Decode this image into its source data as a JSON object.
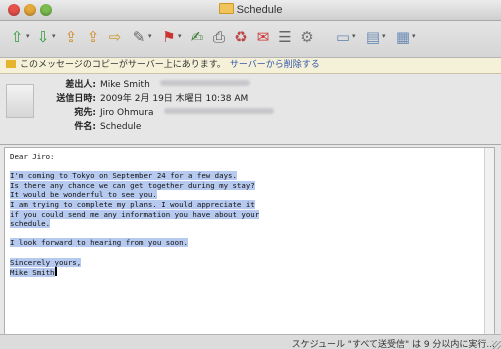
{
  "window": {
    "title": "Schedule"
  },
  "toolbar": {
    "icons": [
      "reply-icon",
      "reply-all-icon",
      "forward-icon",
      "redirect-icon",
      "move-icon",
      "attach-icon",
      "flag-icon",
      "compose-icon",
      "print-icon",
      "delete-icon",
      "junk-icon",
      "list-icon",
      "filter-icon",
      "folder-view-icon",
      "view-icon",
      "more-icon"
    ]
  },
  "notice": {
    "text": "このメッセージのコピーがサーバー上にあります。",
    "link": "サーバーから削除する"
  },
  "header": {
    "from_label": "差出人:",
    "from_value": "Mike Smith",
    "date_label": "送信日時:",
    "date_value": "2009年 2月 19日 木曜日 10:38 AM",
    "to_label": "宛先:",
    "to_value": "Jiro Ohmura",
    "subject_label": "件名:",
    "subject_value": "Schedule"
  },
  "message": {
    "lines": [
      {
        "text": "Dear Jiro:",
        "highlight": false
      },
      {
        "text": "",
        "highlight": false
      },
      {
        "text": "I'm coming to Tokyo on September 24 for a few days.",
        "highlight": true
      },
      {
        "text": "Is there any chance we can get together during my stay?",
        "highlight": true
      },
      {
        "text": "It would be wonderful to see you.",
        "highlight": true
      },
      {
        "text": "I am trying to complete my plans. I would appreciate it",
        "highlight": true
      },
      {
        "text": "if you could send me any information you have about your",
        "highlight": true
      },
      {
        "text": "schedule.",
        "highlight": true
      },
      {
        "text": "",
        "highlight": false
      },
      {
        "text": "I look forward to hearing from you soon.",
        "highlight": true
      },
      {
        "text": "",
        "highlight": false
      },
      {
        "text": "Sincerely yours,",
        "highlight": true
      },
      {
        "text": "Mike Smith",
        "highlight": true
      }
    ]
  },
  "status": {
    "text": "スケジュール \"すべて送受信\" は 9 分以内に実行..."
  },
  "colors": {
    "highlight": "#b6c9ef",
    "link": "#3355aa",
    "notice_bg": "#f4f1d8"
  }
}
